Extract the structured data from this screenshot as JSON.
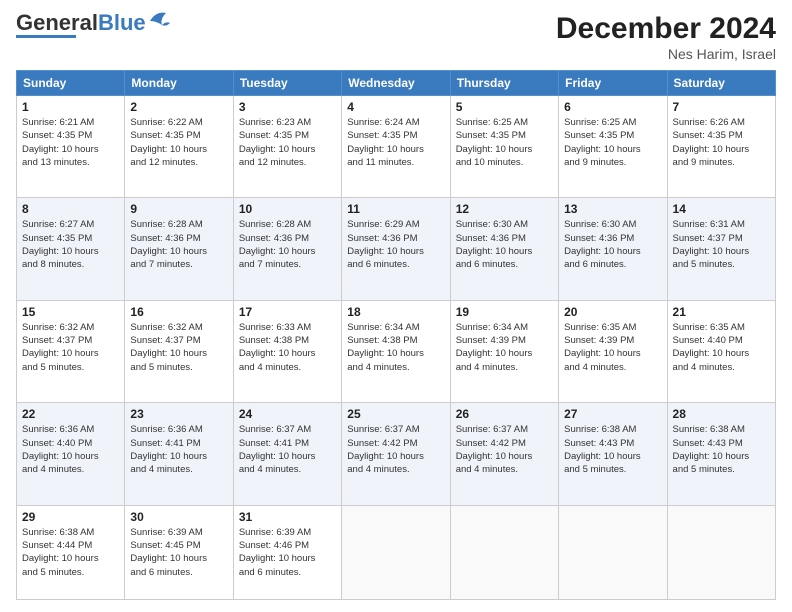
{
  "header": {
    "logo_general": "General",
    "logo_blue": "Blue",
    "month_title": "December 2024",
    "location": "Nes Harim, Israel"
  },
  "days_of_week": [
    "Sunday",
    "Monday",
    "Tuesday",
    "Wednesday",
    "Thursday",
    "Friday",
    "Saturday"
  ],
  "weeks": [
    [
      {
        "day": "1",
        "info": "Sunrise: 6:21 AM\nSunset: 4:35 PM\nDaylight: 10 hours\nand 13 minutes."
      },
      {
        "day": "2",
        "info": "Sunrise: 6:22 AM\nSunset: 4:35 PM\nDaylight: 10 hours\nand 12 minutes."
      },
      {
        "day": "3",
        "info": "Sunrise: 6:23 AM\nSunset: 4:35 PM\nDaylight: 10 hours\nand 12 minutes."
      },
      {
        "day": "4",
        "info": "Sunrise: 6:24 AM\nSunset: 4:35 PM\nDaylight: 10 hours\nand 11 minutes."
      },
      {
        "day": "5",
        "info": "Sunrise: 6:25 AM\nSunset: 4:35 PM\nDaylight: 10 hours\nand 10 minutes."
      },
      {
        "day": "6",
        "info": "Sunrise: 6:25 AM\nSunset: 4:35 PM\nDaylight: 10 hours\nand 9 minutes."
      },
      {
        "day": "7",
        "info": "Sunrise: 6:26 AM\nSunset: 4:35 PM\nDaylight: 10 hours\nand 9 minutes."
      }
    ],
    [
      {
        "day": "8",
        "info": "Sunrise: 6:27 AM\nSunset: 4:35 PM\nDaylight: 10 hours\nand 8 minutes."
      },
      {
        "day": "9",
        "info": "Sunrise: 6:28 AM\nSunset: 4:36 PM\nDaylight: 10 hours\nand 7 minutes."
      },
      {
        "day": "10",
        "info": "Sunrise: 6:28 AM\nSunset: 4:36 PM\nDaylight: 10 hours\nand 7 minutes."
      },
      {
        "day": "11",
        "info": "Sunrise: 6:29 AM\nSunset: 4:36 PM\nDaylight: 10 hours\nand 6 minutes."
      },
      {
        "day": "12",
        "info": "Sunrise: 6:30 AM\nSunset: 4:36 PM\nDaylight: 10 hours\nand 6 minutes."
      },
      {
        "day": "13",
        "info": "Sunrise: 6:30 AM\nSunset: 4:36 PM\nDaylight: 10 hours\nand 6 minutes."
      },
      {
        "day": "14",
        "info": "Sunrise: 6:31 AM\nSunset: 4:37 PM\nDaylight: 10 hours\nand 5 minutes."
      }
    ],
    [
      {
        "day": "15",
        "info": "Sunrise: 6:32 AM\nSunset: 4:37 PM\nDaylight: 10 hours\nand 5 minutes."
      },
      {
        "day": "16",
        "info": "Sunrise: 6:32 AM\nSunset: 4:37 PM\nDaylight: 10 hours\nand 5 minutes."
      },
      {
        "day": "17",
        "info": "Sunrise: 6:33 AM\nSunset: 4:38 PM\nDaylight: 10 hours\nand 4 minutes."
      },
      {
        "day": "18",
        "info": "Sunrise: 6:34 AM\nSunset: 4:38 PM\nDaylight: 10 hours\nand 4 minutes."
      },
      {
        "day": "19",
        "info": "Sunrise: 6:34 AM\nSunset: 4:39 PM\nDaylight: 10 hours\nand 4 minutes."
      },
      {
        "day": "20",
        "info": "Sunrise: 6:35 AM\nSunset: 4:39 PM\nDaylight: 10 hours\nand 4 minutes."
      },
      {
        "day": "21",
        "info": "Sunrise: 6:35 AM\nSunset: 4:40 PM\nDaylight: 10 hours\nand 4 minutes."
      }
    ],
    [
      {
        "day": "22",
        "info": "Sunrise: 6:36 AM\nSunset: 4:40 PM\nDaylight: 10 hours\nand 4 minutes."
      },
      {
        "day": "23",
        "info": "Sunrise: 6:36 AM\nSunset: 4:41 PM\nDaylight: 10 hours\nand 4 minutes."
      },
      {
        "day": "24",
        "info": "Sunrise: 6:37 AM\nSunset: 4:41 PM\nDaylight: 10 hours\nand 4 minutes."
      },
      {
        "day": "25",
        "info": "Sunrise: 6:37 AM\nSunset: 4:42 PM\nDaylight: 10 hours\nand 4 minutes."
      },
      {
        "day": "26",
        "info": "Sunrise: 6:37 AM\nSunset: 4:42 PM\nDaylight: 10 hours\nand 4 minutes."
      },
      {
        "day": "27",
        "info": "Sunrise: 6:38 AM\nSunset: 4:43 PM\nDaylight: 10 hours\nand 5 minutes."
      },
      {
        "day": "28",
        "info": "Sunrise: 6:38 AM\nSunset: 4:43 PM\nDaylight: 10 hours\nand 5 minutes."
      }
    ],
    [
      {
        "day": "29",
        "info": "Sunrise: 6:38 AM\nSunset: 4:44 PM\nDaylight: 10 hours\nand 5 minutes."
      },
      {
        "day": "30",
        "info": "Sunrise: 6:39 AM\nSunset: 4:45 PM\nDaylight: 10 hours\nand 6 minutes."
      },
      {
        "day": "31",
        "info": "Sunrise: 6:39 AM\nSunset: 4:46 PM\nDaylight: 10 hours\nand 6 minutes."
      },
      {
        "day": "",
        "info": ""
      },
      {
        "day": "",
        "info": ""
      },
      {
        "day": "",
        "info": ""
      },
      {
        "day": "",
        "info": ""
      }
    ]
  ]
}
